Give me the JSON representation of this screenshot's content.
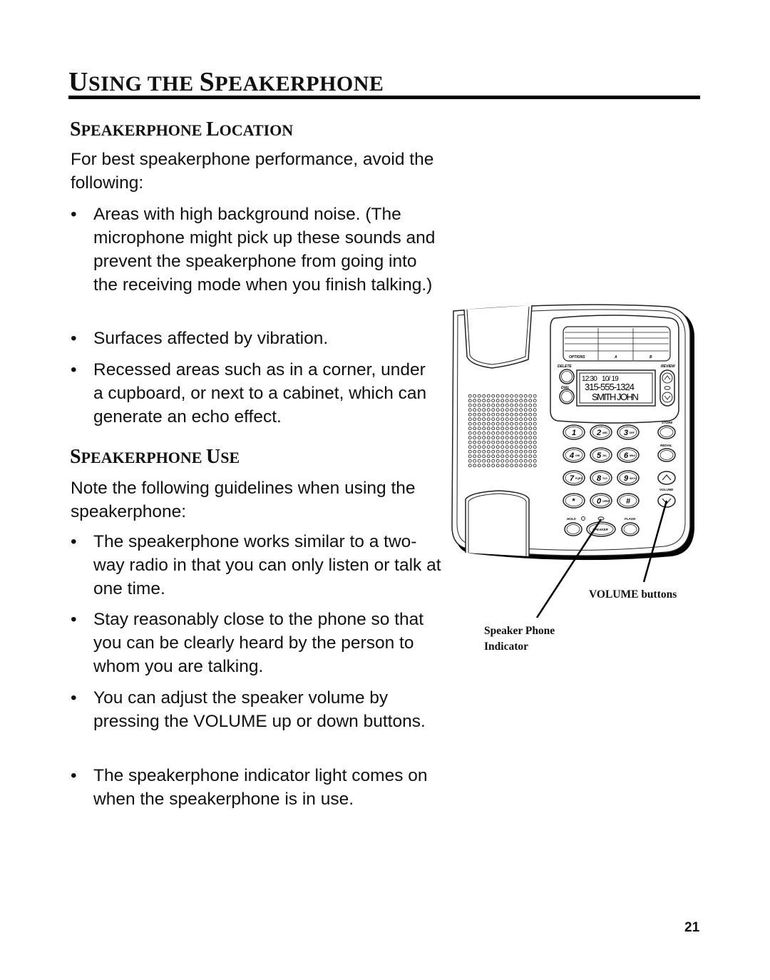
{
  "title": {
    "first": "U",
    "rest1": "SING THE ",
    "cap2": "S",
    "rest2": "PEAKERPHONE"
  },
  "sections": [
    {
      "heading": {
        "cap1": "S",
        "rest1": "PEAKERPHONE ",
        "cap2": "L",
        "rest2": "OCATION"
      },
      "intro": "For best speakerphone performance, avoid the following:",
      "bullets": [
        "Areas with high background noise. (The microphone might pick up these sounds and prevent the speakerphone from going into the receiving mode when you finish talking.)",
        "Surfaces affected by vibration.",
        "Recessed areas such as in a corner, under a cupboard, or next to a cabinet, which can generate an echo effect."
      ]
    },
    {
      "heading": {
        "cap1": "S",
        "rest1": "PEAKERPHONE ",
        "cap2": "U",
        "rest2": "SE"
      },
      "intro": "Note the following guidelines when using the speakerphone:",
      "bullets": [
        "The speakerphone works similar to a two-way radio in that you can only listen or talk at one time.",
        "Stay reasonably close to the phone so that you can be clearly heard by the person to whom you are talking.",
        "You can adjust the speaker volume by pressing the VOLUME up or down buttons.",
        "The speakerphone indicator light comes on when the speakerphone is in use."
      ]
    }
  ],
  "bullet_char": "•",
  "figure": {
    "card_labels": [
      "OPTIONS",
      "A",
      "B"
    ],
    "button_labels": {
      "delete": "DELETE",
      "dial": "DIAL",
      "review": "REVIEW",
      "store": "STORE",
      "redial": "REDIAL",
      "volume": "VOLUME",
      "hold": "HOLD",
      "flash": "FLASH",
      "speaker": "SPEAKER"
    },
    "display": {
      "time": "12:30",
      "date": "10/ 19",
      "number": "315-555-1324",
      "name": "SMITH JOHN"
    },
    "keypad": [
      {
        "digit": "1",
        "letters": ""
      },
      {
        "digit": "2",
        "letters": "ABC"
      },
      {
        "digit": "3",
        "letters": "DEF"
      },
      {
        "digit": "4",
        "letters": "GHI"
      },
      {
        "digit": "5",
        "letters": "JKL"
      },
      {
        "digit": "6",
        "letters": "MNO"
      },
      {
        "digit": "7",
        "letters": "PQRS"
      },
      {
        "digit": "8",
        "letters": "TUV"
      },
      {
        "digit": "9",
        "letters": "WXYZ"
      },
      {
        "digit": "*",
        "letters": ""
      },
      {
        "digit": "0",
        "letters": "OPER"
      },
      {
        "digit": "#",
        "letters": ""
      }
    ],
    "callouts": {
      "volume": "VOLUME buttons",
      "speaker_line1": "Speaker Phone",
      "speaker_line2": "Indicator"
    }
  },
  "page_number": "21"
}
